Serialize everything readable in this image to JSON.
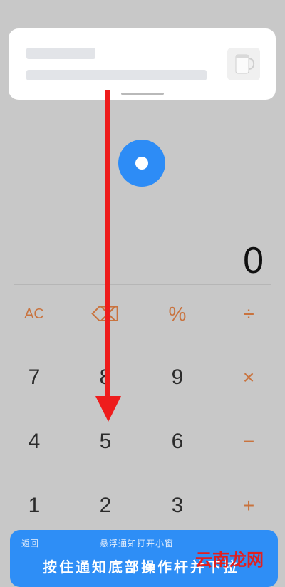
{
  "display": {
    "value": "0"
  },
  "keys": [
    {
      "label": "AC",
      "name": "key-ac"
    },
    {
      "label": "⌫",
      "name": "key-backspace"
    },
    {
      "label": "%",
      "name": "key-percent"
    },
    {
      "label": "÷",
      "name": "key-divide"
    },
    {
      "label": "7",
      "name": "key-7"
    },
    {
      "label": "8",
      "name": "key-8"
    },
    {
      "label": "9",
      "name": "key-9"
    },
    {
      "label": "×",
      "name": "key-multiply"
    },
    {
      "label": "4",
      "name": "key-4"
    },
    {
      "label": "5",
      "name": "key-5"
    },
    {
      "label": "6",
      "name": "key-6"
    },
    {
      "label": "−",
      "name": "key-minus"
    },
    {
      "label": "1",
      "name": "key-1"
    },
    {
      "label": "2",
      "name": "key-2"
    },
    {
      "label": "3",
      "name": "key-3"
    },
    {
      "label": "+",
      "name": "key-plus"
    }
  ],
  "banner": {
    "back_label": "返回",
    "subtitle": "悬浮通知打开小窗",
    "main_text": "按住通知底部操作杆并下拉"
  },
  "watermark": {
    "text": "云南龙网"
  },
  "colors": {
    "accent": "#2d8cf6",
    "operator": "#c9733e",
    "arrow": "#ee1c1c"
  }
}
